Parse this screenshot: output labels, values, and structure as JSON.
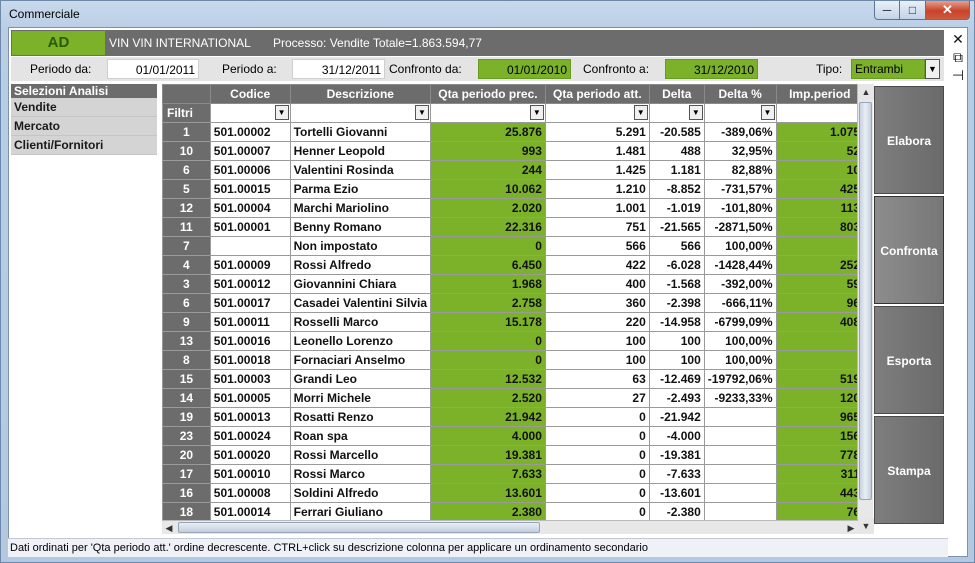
{
  "window": {
    "title": "Commerciale",
    "min_glyph": "─",
    "max_glyph": "□",
    "close_glyph": "✕"
  },
  "header": {
    "badge": "AD",
    "company": "VIN VIN INTERNATIONAL",
    "process": "Processo: Vendite Totale=1.863.594,77"
  },
  "filters": {
    "periodo_da_label": "Periodo da:",
    "periodo_da": "01/01/2011",
    "periodo_a_label": "Periodo a:",
    "periodo_a": "31/12/2011",
    "confronto_da_label": "Confronto da:",
    "confronto_da": "01/01/2010",
    "confronto_a_label": "Confronto a:",
    "confronto_a": "31/12/2010",
    "tipo_label": "Tipo:",
    "tipo": "Entrambi"
  },
  "side_tools": {
    "close": "✕",
    "t2": "⧉",
    "pin": "⊣"
  },
  "selections": {
    "title": "Selezioni Analisi",
    "items": [
      "Vendite",
      "Mercato",
      "Clienti/Fornitori"
    ]
  },
  "grid": {
    "columns": [
      "",
      "Codice",
      "Descrizione",
      "Qta periodo prec.",
      "Qta periodo att.",
      "Delta",
      "Delta %",
      "Imp.period"
    ],
    "filter_label": "Filtri",
    "rows": [
      [
        "1",
        "501.00002",
        "Tortelli Giovanni",
        "25.876",
        "5.291",
        "-20.585",
        "-389,06%",
        "1.075"
      ],
      [
        "10",
        "501.00007",
        "Henner Leopold",
        "993",
        "1.481",
        "488",
        "32,95%",
        "52"
      ],
      [
        "6",
        "501.00006",
        "Valentini Rosinda",
        "244",
        "1.425",
        "1.181",
        "82,88%",
        "10"
      ],
      [
        "5",
        "501.00015",
        "Parma Ezio",
        "10.062",
        "1.210",
        "-8.852",
        "-731,57%",
        "425"
      ],
      [
        "12",
        "501.00004",
        "Marchi Mariolino",
        "2.020",
        "1.001",
        "-1.019",
        "-101,80%",
        "113"
      ],
      [
        "11",
        "501.00001",
        "Benny Romano",
        "22.316",
        "751",
        "-21.565",
        "-2871,50%",
        "803"
      ],
      [
        "7",
        "",
        "Non impostato",
        "0",
        "566",
        "566",
        "100,00%",
        ""
      ],
      [
        "4",
        "501.00009",
        "Rossi Alfredo",
        "6.450",
        "422",
        "-6.028",
        "-1428,44%",
        "252"
      ],
      [
        "3",
        "501.00012",
        "Giovannini Chiara",
        "1.968",
        "400",
        "-1.568",
        "-392,00%",
        "59"
      ],
      [
        "6",
        "501.00017",
        "Casadei Valentini Silvia",
        "2.758",
        "360",
        "-2.398",
        "-666,11%",
        "96"
      ],
      [
        "9",
        "501.00011",
        "Rosselli Marco",
        "15.178",
        "220",
        "-14.958",
        "-6799,09%",
        "408"
      ],
      [
        "13",
        "501.00016",
        "Leonello Lorenzo",
        "0",
        "100",
        "100",
        "100,00%",
        ""
      ],
      [
        "8",
        "501.00018",
        "Fornaciari Anselmo",
        "0",
        "100",
        "100",
        "100,00%",
        ""
      ],
      [
        "15",
        "501.00003",
        "Grandi Leo",
        "12.532",
        "63",
        "-12.469",
        "-19792,06%",
        "519"
      ],
      [
        "14",
        "501.00005",
        "Morri Michele",
        "2.520",
        "27",
        "-2.493",
        "-9233,33%",
        "120"
      ],
      [
        "19",
        "501.00013",
        "Rosatti Renzo",
        "21.942",
        "0",
        "-21.942",
        "",
        "965"
      ],
      [
        "23",
        "501.00024",
        "Roan spa",
        "4.000",
        "0",
        "-4.000",
        "",
        "156"
      ],
      [
        "20",
        "501.00020",
        "Rossi Marcello",
        "19.381",
        "0",
        "-19.381",
        "",
        "778"
      ],
      [
        "17",
        "501.00010",
        "Rossi Marco",
        "7.633",
        "0",
        "-7.633",
        "",
        "311"
      ],
      [
        "16",
        "501.00008",
        "Soldini Alfredo",
        "13.601",
        "0",
        "-13.601",
        "",
        "443"
      ],
      [
        "18",
        "501.00014",
        "Ferrari Giuliano",
        "2.380",
        "0",
        "-2.380",
        "",
        "76"
      ]
    ]
  },
  "actions": [
    "Elabora",
    "Confronta",
    "Esporta",
    "Stampa"
  ],
  "status": "Dati ordinati per 'Qta periodo att.' ordine decrescente. CTRL+click su descrizione colonna per applicare un ordinamento secondario",
  "colors": {
    "green": "#7cb22a",
    "dark": "#6c6c6c"
  }
}
